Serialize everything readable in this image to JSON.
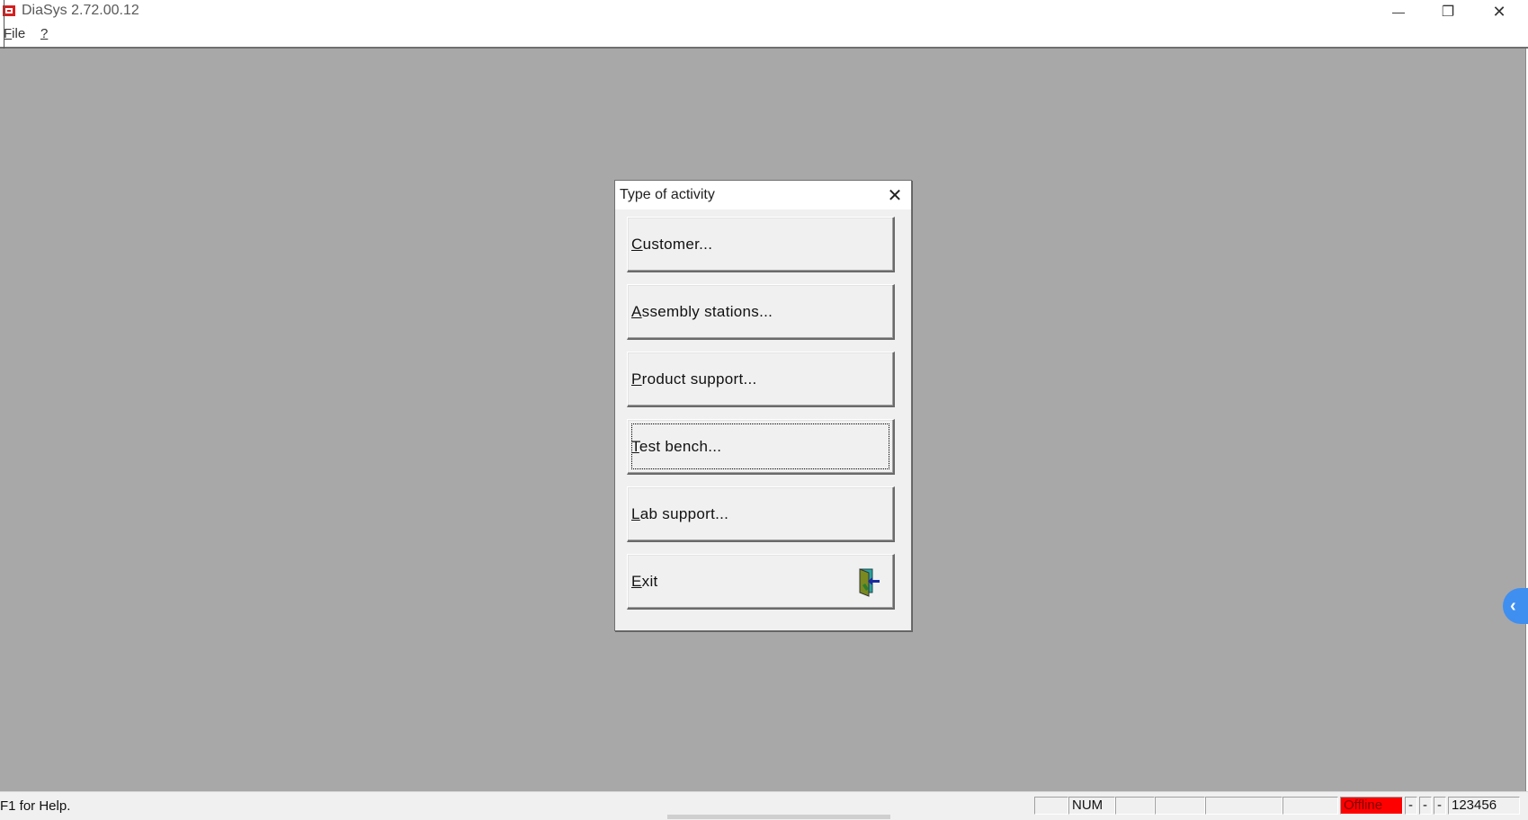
{
  "window": {
    "title": "DiaSys 2.72.00.12",
    "minimize_glyph": "—",
    "restore_glyph": "❐",
    "close_glyph": "✕"
  },
  "menu": {
    "file": "ile",
    "file_mnemonic": "F",
    "help": "?"
  },
  "dialog": {
    "title": "Type of activity",
    "close_glyph": "✕",
    "buttons": [
      {
        "mnemonic": "C",
        "rest": "ustomer..."
      },
      {
        "mnemonic": "A",
        "rest": "ssembly stations..."
      },
      {
        "mnemonic": "P",
        "rest": "roduct support..."
      },
      {
        "mnemonic": "T",
        "rest": "est bench..."
      },
      {
        "mnemonic": "L",
        "rest": "ab support..."
      },
      {
        "mnemonic": "E",
        "rest": "xit"
      }
    ]
  },
  "side_arrow": "‹",
  "status": {
    "help_text": "F1 for Help.",
    "num": "NUM",
    "offline": "Offline",
    "dash1": "-",
    "dash2": "-",
    "dash3": "-",
    "code": "123456"
  },
  "colors": {
    "client_bg": "#a8a8a8",
    "offline_bg": "#ff0000",
    "accent_blue": "#3f8ff0"
  },
  "icons": {
    "app": "app-icon",
    "exit": "exit-door-icon",
    "side": "chevron-left-icon"
  }
}
